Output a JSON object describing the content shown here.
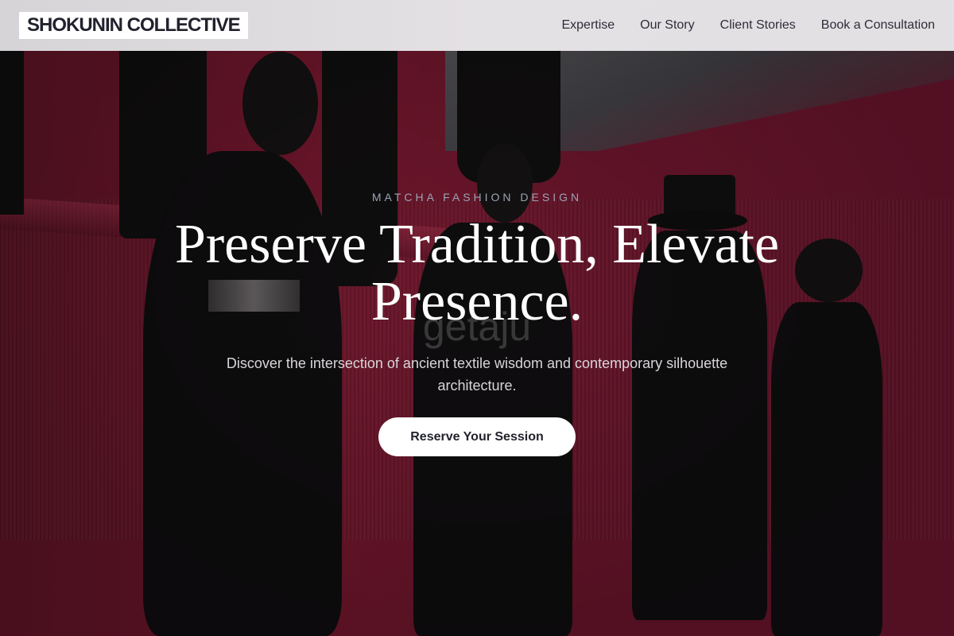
{
  "header": {
    "brand": "SHOKUNIN COLLECTIVE",
    "nav": [
      {
        "label": "Expertise"
      },
      {
        "label": "Our Story"
      },
      {
        "label": "Client Stories"
      },
      {
        "label": "Book a Consultation"
      }
    ]
  },
  "hero": {
    "eyebrow": "MATCHA FASHION DESIGN",
    "headline": "Preserve Tradition, Elevate Presence.",
    "watermark": "getaju",
    "subtitle": "Discover the intersection of ancient textile wisdom and contemporary silhouette architecture.",
    "cta_label": "Reserve Your Session"
  },
  "colors": {
    "header_bg": "#e2e0e2",
    "brand_text": "#22222e",
    "hero_magenta": "#9a1f3c",
    "cta_bg": "#ffffff"
  }
}
